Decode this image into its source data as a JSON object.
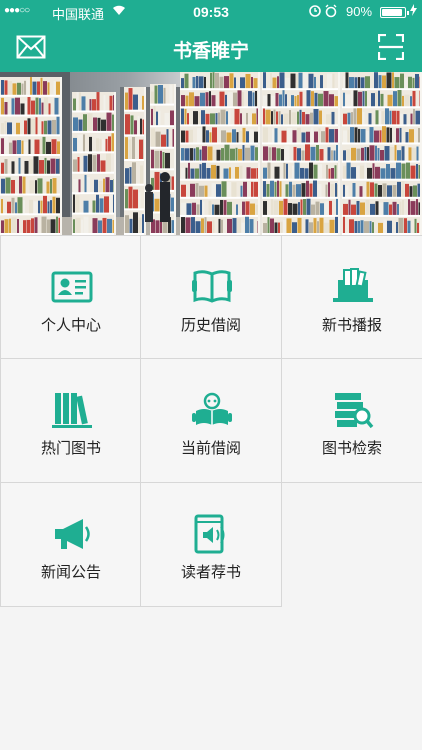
{
  "status_bar": {
    "signal": "●●●○○",
    "carrier": "中国联通",
    "time": "09:53",
    "battery": "90%",
    "battery_level": 0.9
  },
  "nav": {
    "title": "书香睢宁",
    "left_icon": "mail-icon",
    "right_icon": "scan-icon"
  },
  "banner": {
    "dots_total": 3,
    "active_dot": 1
  },
  "menu": [
    {
      "label": "个人中心",
      "icon": "id-card-icon"
    },
    {
      "label": "历史借阅",
      "icon": "open-book-icon"
    },
    {
      "label": "新书播报",
      "icon": "laptop-books-icon"
    },
    {
      "label": "热门图书",
      "icon": "bookshelf-icon"
    },
    {
      "label": "当前借阅",
      "icon": "reader-icon"
    },
    {
      "label": "图书检索",
      "icon": "book-search-icon"
    },
    {
      "label": "新闻公告",
      "icon": "megaphone-icon"
    },
    {
      "label": "读者荐书",
      "icon": "book-speaker-icon"
    }
  ],
  "colors": {
    "accent": "#1fae92",
    "background": "#f4f4f4",
    "cell_border": "#d7d7d7"
  }
}
